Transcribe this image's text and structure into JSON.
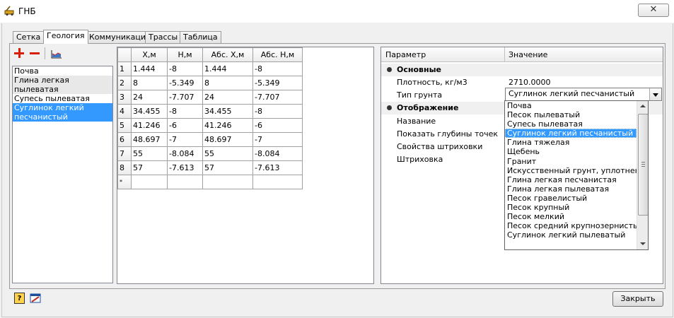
{
  "window": {
    "title": "ГНБ",
    "close_glyph": "✕"
  },
  "tabs": [
    "Сетка",
    "Геология",
    "Коммуникации",
    "Трассы",
    "Таблица"
  ],
  "active_tab": "Геология",
  "toolbar": {
    "add_icon": "plus-icon",
    "remove_icon": "minus-icon",
    "profile_icon": "profile-chart-icon"
  },
  "layers": [
    {
      "label": "Почва"
    },
    {
      "label": "Глина легкая пылеватая"
    },
    {
      "label": "Супесь пылеватая"
    },
    {
      "label": "Суглинок легкий песчанистый"
    }
  ],
  "selected_layer": "Суглинок легкий песчанистый",
  "grid": {
    "columns": [
      "",
      "X,м",
      "Н,м",
      "Абс. X,м",
      "Абс. Н,м"
    ],
    "rows": [
      [
        "1",
        "1.444",
        "-8",
        "1.444",
        "-8"
      ],
      [
        "2",
        "8",
        "-5.349",
        "8",
        "-5.349"
      ],
      [
        "3",
        "24",
        "-7.707",
        "24",
        "-7.707"
      ],
      [
        "4",
        "34.455",
        "-8",
        "34.455",
        "-8"
      ],
      [
        "5",
        "41.246",
        "-6",
        "41.246",
        "-6"
      ],
      [
        "6",
        "48.697",
        "-7",
        "48.697",
        "-7"
      ],
      [
        "7",
        "55",
        "-8.084",
        "55",
        "-8.084"
      ],
      [
        "8",
        "57",
        "-7.613",
        "57",
        "-7.613"
      ]
    ],
    "new_row_marker": "*"
  },
  "properties": {
    "header_param": "Параметр",
    "header_value": "Значение",
    "cat_main": "Основные",
    "density_label": "Плотность, кг/м3",
    "density_value": "2710.0000",
    "soil_label": "Тип грунта",
    "soil_value": "Суглинок легкий песчанистый",
    "cat_display": "Отображение",
    "name_label": "Название",
    "show_depth_label": "Показать глубины точек",
    "hatch_props_label": "Свойства штриховки",
    "hatch_label": "Штриховка"
  },
  "soil_options": [
    "Почва",
    "Песок пылеватый",
    "Супесь пылеватая",
    "Суглинок легкий песчанистый",
    "Глина тяжелая",
    "Щебень",
    "Гранит",
    "Искусственный грунт, уплотненный",
    "Глина легкая песчанистая",
    "Глина легкая пылеватая",
    "Песок гравелистый",
    "Песок крупный",
    "Песок мелкий",
    "Песок средний крупнозернистый",
    "Суглинок легкий пылеватый"
  ],
  "selected_option": "Суглинок легкий песчанистый",
  "buttons": {
    "close": "Закрыть"
  },
  "bottom_icons": [
    "help-icon",
    "settings-icon"
  ],
  "colors": {
    "selection": "#3399ff",
    "accent_red": "#d81e05"
  }
}
